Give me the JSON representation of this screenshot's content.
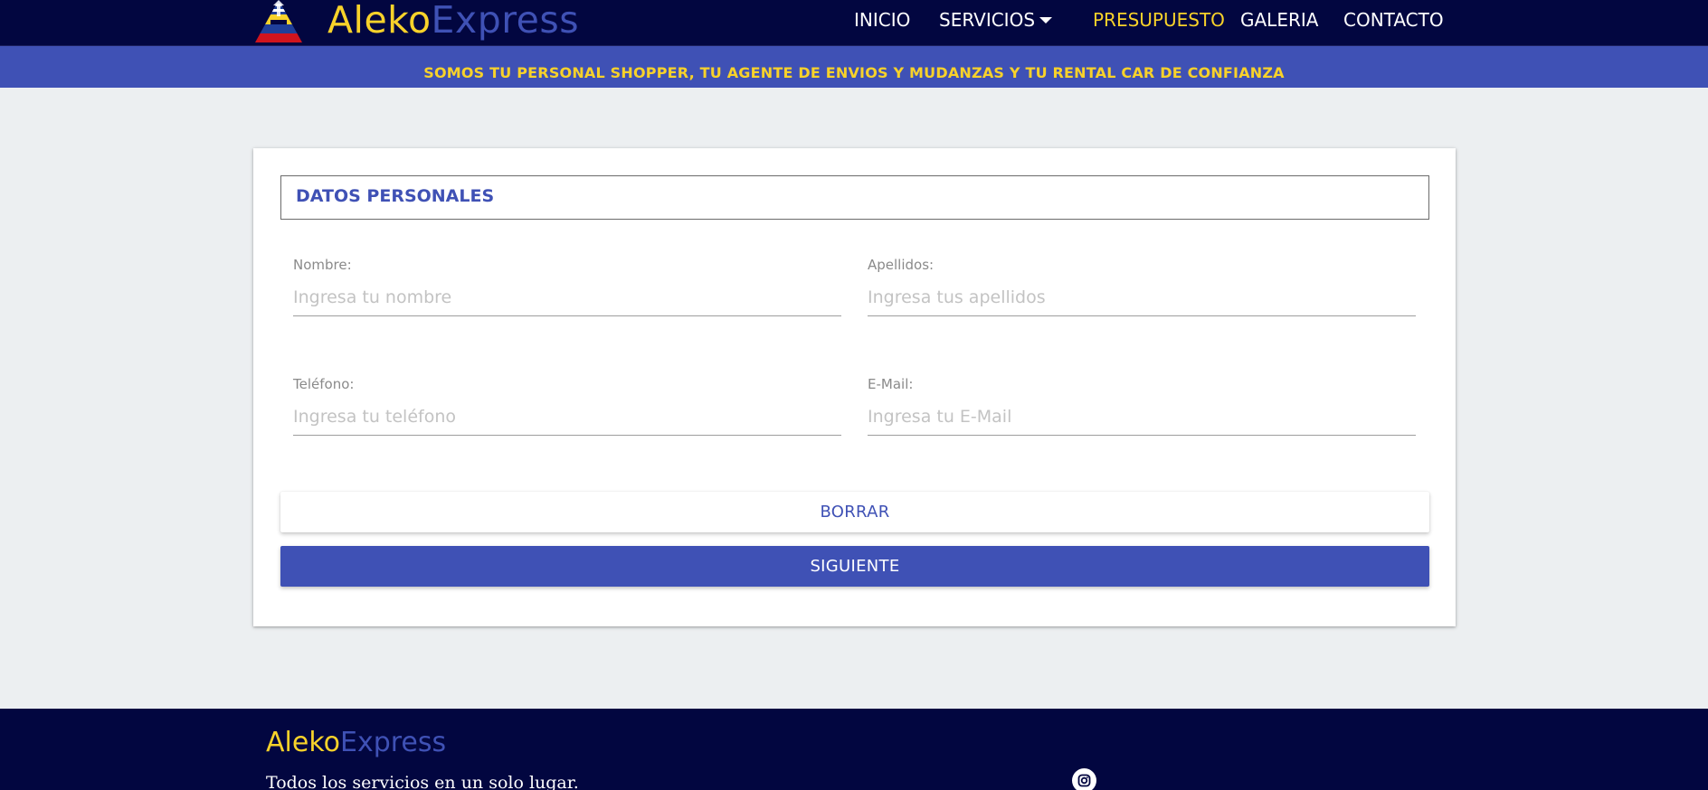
{
  "brand": {
    "part1": "Aleko",
    "part2": "Express"
  },
  "nav": {
    "items": [
      {
        "label": "INICIO"
      },
      {
        "label": "SERVICIOS"
      },
      {
        "label": "PRESUPUESTO"
      },
      {
        "label": "GALERIA"
      },
      {
        "label": "CONTACTO"
      }
    ],
    "active": "PRESUPUESTO"
  },
  "banner": {
    "text": "SOMOS TU PERSONAL SHOPPER, TU AGENTE DE ENVIOS Y MUDANZAS Y TU RENTAL CAR DE CONFIANZA"
  },
  "form": {
    "section_title": "DATOS PERSONALES",
    "fields": {
      "nombre": {
        "label": "Nombre:",
        "placeholder": "Ingresa tu nombre",
        "value": ""
      },
      "apellidos": {
        "label": "Apellidos:",
        "placeholder": "Ingresa tus apellidos",
        "value": ""
      },
      "telefono": {
        "label": "Teléfono:",
        "placeholder": "Ingresa tu teléfono",
        "value": ""
      },
      "email": {
        "label": "E-Mail:",
        "placeholder": "Ingresa tu E-Mail",
        "value": ""
      }
    },
    "clear_label": "BORRAR",
    "next_label": "SIGUIENTE"
  },
  "footer": {
    "brand_part1": "Aleko",
    "brand_part2": "Express",
    "tagline": "Todos los servicios en un solo lugar.",
    "social_icon": "instagram-icon"
  },
  "colors": {
    "navy": "#020640",
    "indigo": "#3f51b5",
    "yellow": "#f8d22a",
    "page_bg": "#eceff1"
  }
}
